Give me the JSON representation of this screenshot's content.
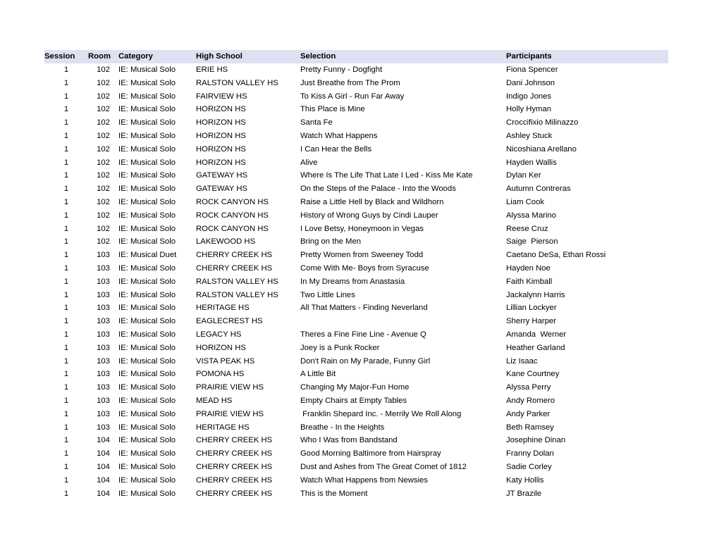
{
  "table": {
    "columns": [
      {
        "key": "session",
        "label": "Session"
      },
      {
        "key": "room",
        "label": "Room"
      },
      {
        "key": "category",
        "label": "Category"
      },
      {
        "key": "school",
        "label": "High School"
      },
      {
        "key": "selection",
        "label": "Selection"
      },
      {
        "key": "participants",
        "label": "Participants"
      }
    ],
    "header_background": "#dde1f2",
    "rows": [
      {
        "session": "1",
        "room": "102",
        "category": "IE: Musical Solo",
        "school": "ERIE HS",
        "selection": "Pretty Funny - Dogfight",
        "participants": "Fiona Spencer"
      },
      {
        "session": "1",
        "room": "102",
        "category": "IE: Musical Solo",
        "school": "RALSTON VALLEY HS",
        "selection": "Just Breathe from The Prom",
        "participants": "Dani Johnson"
      },
      {
        "session": "1",
        "room": "102",
        "category": "IE: Musical Solo",
        "school": "FAIRVIEW HS",
        "selection": "To Kiss A Girl - Run Far Away",
        "participants": "Indigo Jones"
      },
      {
        "session": "1",
        "room": "102",
        "category": "IE: Musical Solo",
        "school": "HORIZON HS",
        "selection": "This Place is Mine",
        "participants": "Holly Hyman"
      },
      {
        "session": "1",
        "room": "102",
        "category": "IE: Musical Solo",
        "school": "HORIZON HS",
        "selection": "Santa Fe",
        "participants": "Croccifixio Milinazzo"
      },
      {
        "session": "1",
        "room": "102",
        "category": "IE: Musical Solo",
        "school": "HORIZON HS",
        "selection": "Watch What Happens",
        "participants": "Ashley Stuck"
      },
      {
        "session": "1",
        "room": "102",
        "category": "IE: Musical Solo",
        "school": "HORIZON HS",
        "selection": "I Can Hear the Bells",
        "participants": "Nicoshiana Arellano"
      },
      {
        "session": "1",
        "room": "102",
        "category": "IE: Musical Solo",
        "school": "HORIZON HS",
        "selection": "Alive",
        "participants": "Hayden Wallis"
      },
      {
        "session": "1",
        "room": "102",
        "category": "IE: Musical Solo",
        "school": "GATEWAY HS",
        "selection": "Where Is The Life That Late I Led - Kiss Me Kate",
        "participants": "Dylan Ker"
      },
      {
        "session": "1",
        "room": "102",
        "category": "IE: Musical Solo",
        "school": "GATEWAY HS",
        "selection": "On the Steps of the Palace - Into the Woods",
        "participants": "Autumn Contreras"
      },
      {
        "session": "1",
        "room": "102",
        "category": "IE: Musical Solo",
        "school": "ROCK CANYON HS",
        "selection": "Raise a Little Hell by Black and Wildhorn",
        "participants": "Liam Cook"
      },
      {
        "session": "1",
        "room": "102",
        "category": "IE: Musical Solo",
        "school": "ROCK CANYON HS",
        "selection": "History of Wrong Guys by Cindi Lauper",
        "participants": "Alyssa Marino"
      },
      {
        "session": "1",
        "room": "102",
        "category": "IE: Musical Solo",
        "school": "ROCK CANYON HS",
        "selection": "I Love Betsy, Honeymoon in Vegas",
        "participants": "Reese Cruz"
      },
      {
        "session": "1",
        "room": "102",
        "category": "IE: Musical Solo",
        "school": "LAKEWOOD HS",
        "selection": "Bring on the Men",
        "participants": "Saige  Pierson"
      },
      {
        "session": "1",
        "room": "103",
        "category": "IE: Musical Duet",
        "school": "CHERRY CREEK HS",
        "selection": "Pretty Women from Sweeney Todd",
        "participants": "Caetano DeSa, Ethan Rossi"
      },
      {
        "session": "1",
        "room": "103",
        "category": "IE: Musical Solo",
        "school": "CHERRY CREEK HS",
        "selection": "Come With Me- Boys from Syracuse",
        "participants": "Hayden Noe"
      },
      {
        "session": "1",
        "room": "103",
        "category": "IE: Musical Solo",
        "school": "RALSTON VALLEY HS",
        "selection": "In My Dreams from Anastasia",
        "participants": "Faith Kimball"
      },
      {
        "session": "1",
        "room": "103",
        "category": "IE: Musical Solo",
        "school": "RALSTON VALLEY HS",
        "selection": "Two Little Lines",
        "participants": "Jackalynn Harris"
      },
      {
        "session": "1",
        "room": "103",
        "category": "IE: Musical Solo",
        "school": "HERITAGE HS",
        "selection": "All That Matters - Finding Neverland",
        "participants": "Lillian Lockyer"
      },
      {
        "session": "1",
        "room": "103",
        "category": "IE: Musical Solo",
        "school": "EAGLECREST HS",
        "selection": "",
        "participants": "Sherry Harper"
      },
      {
        "session": "1",
        "room": "103",
        "category": "IE: Musical Solo",
        "school": "LEGACY HS",
        "selection": "Theres a Fine Fine Line - Avenue Q",
        "participants": "Amanda  Werner"
      },
      {
        "session": "1",
        "room": "103",
        "category": "IE: Musical Solo",
        "school": "HORIZON HS",
        "selection": "Joey is a Punk Rocker",
        "participants": "Heather Garland"
      },
      {
        "session": "1",
        "room": "103",
        "category": "IE: Musical Solo",
        "school": "VISTA PEAK HS",
        "selection": "Don't Rain on My Parade, Funny Girl",
        "participants": "Liz Isaac"
      },
      {
        "session": "1",
        "room": "103",
        "category": "IE: Musical Solo",
        "school": "POMONA HS",
        "selection": "A Little Bit",
        "participants": "Kane Courtney"
      },
      {
        "session": "1",
        "room": "103",
        "category": "IE: Musical Solo",
        "school": "PRAIRIE VIEW HS",
        "selection": "Changing My Major-Fun Home",
        "participants": "Alyssa Perry"
      },
      {
        "session": "1",
        "room": "103",
        "category": "IE: Musical Solo",
        "school": "MEAD HS",
        "selection": "Empty Chairs at Empty Tables",
        "participants": "Andy Romero"
      },
      {
        "session": "1",
        "room": "103",
        "category": "IE: Musical Solo",
        "school": "PRAIRIE VIEW HS",
        "selection": " Franklin Shepard Inc. - Merrily We Roll Along",
        "participants": "Andy Parker"
      },
      {
        "session": "1",
        "room": "103",
        "category": "IE: Musical Solo",
        "school": "HERITAGE HS",
        "selection": "Breathe - In the Heights",
        "participants": "Beth Ramsey"
      },
      {
        "session": "1",
        "room": "104",
        "category": "IE: Musical Solo",
        "school": "CHERRY CREEK HS",
        "selection": "Who I Was from Bandstand",
        "participants": "Josephine Dinan"
      },
      {
        "session": "1",
        "room": "104",
        "category": "IE: Musical Solo",
        "school": "CHERRY CREEK HS",
        "selection": "Good Morning Baltimore from Hairspray",
        "participants": "Franny Dolan"
      },
      {
        "session": "1",
        "room": "104",
        "category": "IE: Musical Solo",
        "school": "CHERRY CREEK HS",
        "selection": "Dust and Ashes from The Great Comet of 1812",
        "participants": "Sadie Corley"
      },
      {
        "session": "1",
        "room": "104",
        "category": "IE: Musical Solo",
        "school": "CHERRY CREEK HS",
        "selection": "Watch What Happens from Newsies",
        "participants": "Katy Hollis"
      },
      {
        "session": "1",
        "room": "104",
        "category": "IE: Musical Solo",
        "school": "CHERRY CREEK HS",
        "selection": "This is the Moment",
        "participants": "JT Brazile"
      }
    ]
  }
}
